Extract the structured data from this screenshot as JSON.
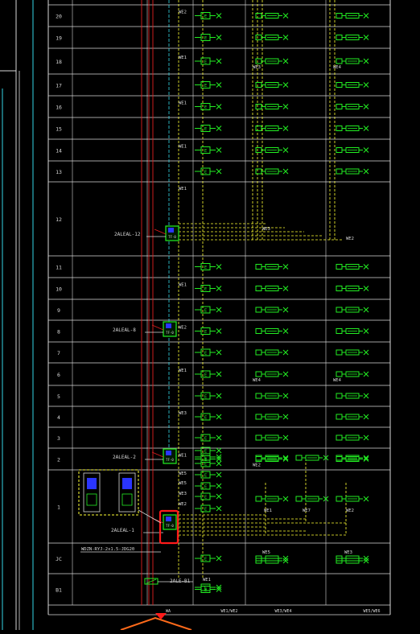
{
  "floors": [
    {
      "label": "20",
      "wires": [
        "WE2"
      ]
    },
    {
      "label": "19",
      "wires": []
    },
    {
      "label": "18",
      "wires": [
        "WE1",
        "WE3",
        "WE4"
      ]
    },
    {
      "label": "17",
      "wires": []
    },
    {
      "label": "16",
      "wires": [
        "WE1"
      ]
    },
    {
      "label": "15",
      "wires": []
    },
    {
      "label": "14",
      "wires": [
        "WE1"
      ]
    },
    {
      "label": "13",
      "wires": []
    },
    {
      "label": "12",
      "wires": [
        "WE1",
        "WE3",
        "WE2"
      ],
      "panel": "2ALEAL-12"
    },
    {
      "label": "11",
      "wires": []
    },
    {
      "label": "10",
      "wires": [
        "WE1"
      ]
    },
    {
      "label": "9",
      "wires": []
    },
    {
      "label": "8",
      "wires": [
        "WE2"
      ],
      "panel": "2ALEAL-8"
    },
    {
      "label": "7",
      "wires": []
    },
    {
      "label": "6",
      "wires": [
        "WE1",
        "WE4",
        "WE4"
      ]
    },
    {
      "label": "5",
      "wires": []
    },
    {
      "label": "4",
      "wires": [
        "WE3"
      ]
    },
    {
      "label": "3",
      "wires": []
    },
    {
      "label": "2",
      "wires": [
        "WE1",
        "WE2"
      ],
      "panel": "2ALEAL-2"
    },
    {
      "label": "1",
      "wires": [
        "WE5",
        "WE5",
        "WE3",
        "WE2",
        "WE1",
        "WE7",
        "WE2"
      ],
      "panel": "2ALEAL-1"
    },
    {
      "label": "JC",
      "wires": [
        "WE5",
        "WE3"
      ]
    },
    {
      "label": "B1",
      "wires": [
        "WE1"
      ],
      "panel": "2ALE-B1"
    }
  ],
  "cable_spec": "WDZN-RYJ-2x1.5-JDG20",
  "panel_text": "TF-0",
  "lamp_label": "E",
  "footer_labels": [
    "WA",
    "WE1/WE2",
    "WE3/WE4",
    "WE5/WE6"
  ],
  "colors": {
    "background": "#000000",
    "grid": "#d8d8d8",
    "fixture": "#22ee22",
    "bus": "#ffff33",
    "riser": "#e02020",
    "cyan": "#33d6e6",
    "highlight": "#ff1a1a",
    "arrow": "#ff6a1a"
  }
}
